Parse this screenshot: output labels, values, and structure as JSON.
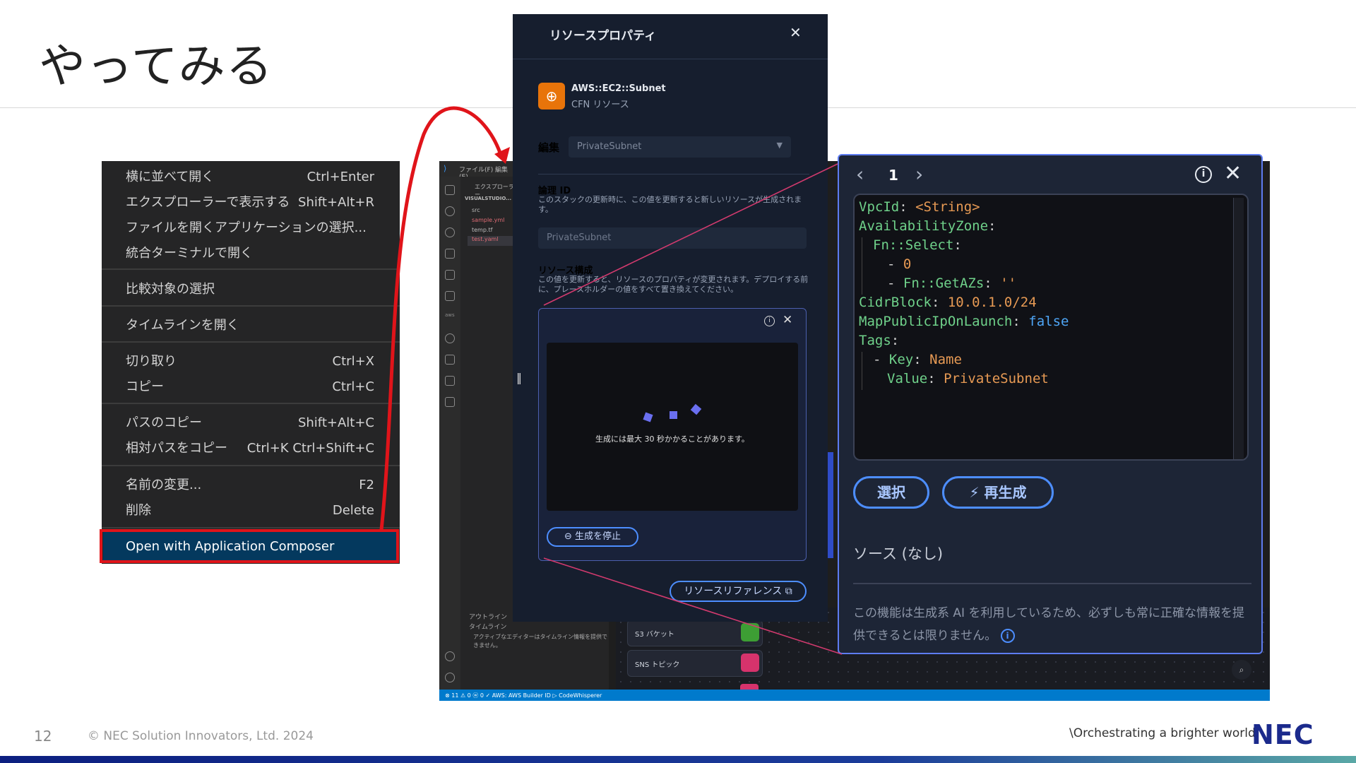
{
  "slide": {
    "title": "やってみる",
    "page_number": "12",
    "copyright": "© NEC Solution Innovators, Ltd. 2024",
    "tagline": "\\Orchestrating a brighter world",
    "logo_text": "NEC"
  },
  "context_menu": {
    "items": [
      {
        "label": "横に並べて開く",
        "shortcut": "Ctrl+Enter"
      },
      {
        "label": "エクスプローラーで表示する",
        "shortcut": "Shift+Alt+R"
      },
      {
        "label": "ファイルを開くアプリケーションの選択...",
        "shortcut": ""
      },
      {
        "label": "統合ターミナルで開く",
        "shortcut": ""
      },
      {
        "label": "比較対象の選択",
        "shortcut": ""
      },
      {
        "label": "タイムラインを開く",
        "shortcut": ""
      },
      {
        "label": "切り取り",
        "shortcut": "Ctrl+X"
      },
      {
        "label": "コピー",
        "shortcut": "Ctrl+C"
      },
      {
        "label": "パスのコピー",
        "shortcut": "Shift+Alt+C"
      },
      {
        "label": "相対パスをコピー",
        "shortcut": "Ctrl+K Ctrl+Shift+C"
      },
      {
        "label": "名前の変更...",
        "shortcut": "F2"
      },
      {
        "label": "削除",
        "shortcut": "Delete"
      }
    ],
    "highlighted_item": "Open with Application Composer"
  },
  "vscode": {
    "menu": "ファイル(F)  編集(E)",
    "explorer_title": "エクスプローラー",
    "workspace": "VISUALSTUDIO...",
    "files": [
      "src",
      "sample.yml",
      "temp.tf",
      "test.yaml"
    ],
    "outline": "アウトライン",
    "timeline": "タイムライン",
    "timeline_msg": "アクティブなエディターはタイムライン情報を提供できません。",
    "status": "⊗ 11 ⚠ 0   ⓦ 0   ✓ AWS: AWS Builder ID   ▷ CodeWhisperer",
    "resource_cards": [
      "S3 バケット",
      "SNS トピック"
    ]
  },
  "resource_properties": {
    "title": "リソースプロパティ",
    "resource_type": "AWS::EC2::Subnet",
    "resource_kind": "CFN リソース",
    "edit_label": "編集",
    "edit_value": "PrivateSubnet",
    "logical_id_label": "論理 ID",
    "logical_id_desc": "このスタックの更新時に、この値を更新すると新しいリソースが生成されます。",
    "logical_id_value": "PrivateSubnet",
    "config_label": "リソース構成",
    "config_desc": "この値を更新すると、リソースのプロパティが変更されます。デプロイする前に、プレースホルダーの値をすべて置き換えてください。",
    "generating_msg": "生成には最大 30 秒かかることがあります。",
    "stop_button": "生成を停止",
    "reference_button": "リソースリファレンス"
  },
  "ai_popup": {
    "page": "1",
    "code_lines": [
      {
        "indent": 0,
        "key": "VpcId",
        "value": "<String>",
        "vtype": "s"
      },
      {
        "indent": 0,
        "key": "AvailabilityZone",
        "value": "",
        "vtype": "s"
      },
      {
        "indent": 1,
        "key": "Fn::Select",
        "value": "",
        "vtype": "s"
      },
      {
        "indent": 2,
        "dash": true,
        "key": "",
        "value": "0",
        "vtype": "s"
      },
      {
        "indent": 2,
        "dash": true,
        "key": "Fn::GetAZs",
        "value": "''",
        "vtype": "s"
      },
      {
        "indent": 0,
        "key": "CidrBlock",
        "value": "10.0.1.0/24",
        "vtype": "s"
      },
      {
        "indent": 0,
        "key": "MapPublicIpOnLaunch",
        "value": "false",
        "vtype": "b"
      },
      {
        "indent": 0,
        "key": "Tags",
        "value": "",
        "vtype": "s"
      },
      {
        "indent": 1,
        "dash": true,
        "key": "Key",
        "value": "Name",
        "vtype": "s"
      },
      {
        "indent": 2,
        "key": "Value",
        "value": "PrivateSubnet",
        "vtype": "s"
      }
    ],
    "select_button": "選択",
    "regenerate_button": "再生成",
    "source_label": "ソース (なし)",
    "disclaimer": "この機能は生成系 AI を利用しているため、必ずしも常に正確な情報を提供できるとは限りません。"
  },
  "colors": {
    "highlight_red": "#e0141a",
    "accent_blue": "#4d8eff",
    "aws_orange": "#e8740a"
  }
}
